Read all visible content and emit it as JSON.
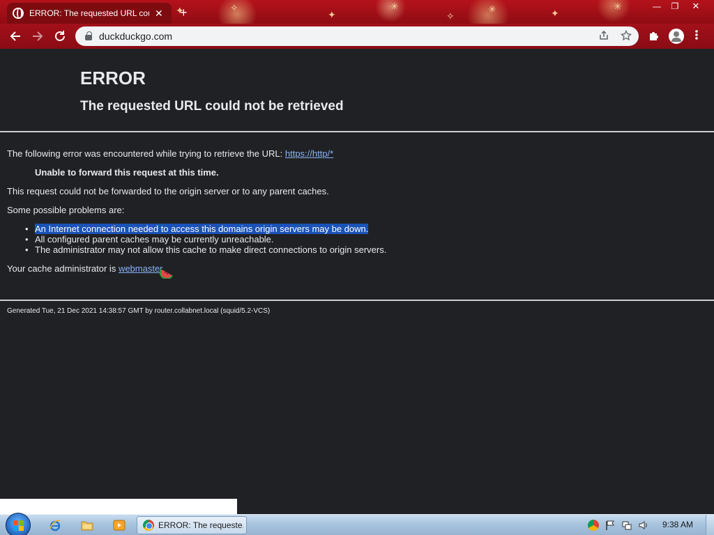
{
  "browser": {
    "tab_title": "ERROR: The requested URL coul",
    "tab_close": "✕",
    "new_tab": "+",
    "url": "duckduckgo.com",
    "window_controls": {
      "minimize": "—",
      "maximize": "❐",
      "close": "✕"
    }
  },
  "page": {
    "h1": "ERROR",
    "h2": "The requested URL could not be retrieved",
    "intro_text": "The following error was encountered while trying to retrieve the URL: ",
    "intro_link": "https://http/*",
    "strong_line": "Unable to forward this request at this time.",
    "para_forward": "This request could not be forwarded to the origin server or to any parent caches.",
    "para_problems": "Some possible problems are:",
    "problems": [
      "An Internet connection needed to access this domains origin servers may be down.",
      "All configured parent caches may be currently unreachable.",
      "The administrator may not allow this cache to make direct connections to origin servers."
    ],
    "admin_text": "Your cache administrator is ",
    "admin_link": "webmaster",
    "admin_suffix": ".",
    "footer": "Generated Tue, 21 Dec 2021 14:38:57 GMT by router.collabnet.local (squid/5.2-VCS)"
  },
  "taskbar": {
    "active_task_label": "ERROR: The requeste...",
    "clock": "9:38 AM"
  },
  "colors": {
    "browser_frame": "#a3101a",
    "page_background": "#202124",
    "page_text": "#e8eaed",
    "link": "#8ab4f8",
    "selection_highlight": "#1a53b6",
    "taskbar": "#a9c4de"
  }
}
